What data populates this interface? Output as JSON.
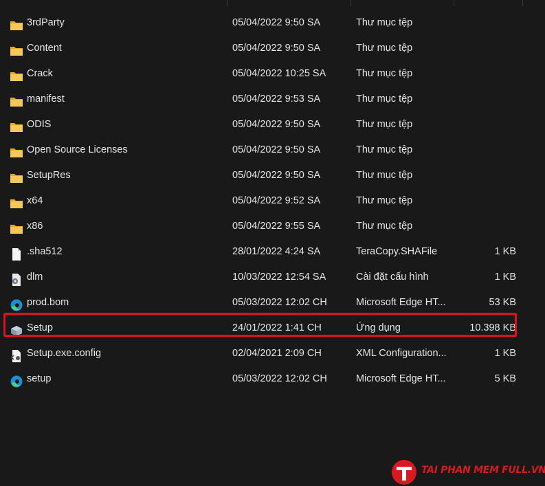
{
  "files": [
    {
      "name": "3rdParty",
      "date": "05/04/2022 9:50 SA",
      "type": "Thư mục tệp",
      "size": "",
      "icon": "folder-icon"
    },
    {
      "name": "Content",
      "date": "05/04/2022 9:50 SA",
      "type": "Thư mục tệp",
      "size": "",
      "icon": "folder-icon"
    },
    {
      "name": "Crack",
      "date": "05/04/2022 10:25 SA",
      "type": "Thư mục tệp",
      "size": "",
      "icon": "folder-icon"
    },
    {
      "name": "manifest",
      "date": "05/04/2022 9:53 SA",
      "type": "Thư mục tệp",
      "size": "",
      "icon": "folder-icon"
    },
    {
      "name": "ODIS",
      "date": "05/04/2022 9:50 SA",
      "type": "Thư mục tệp",
      "size": "",
      "icon": "folder-icon"
    },
    {
      "name": "Open Source Licenses",
      "date": "05/04/2022 9:50 SA",
      "type": "Thư mục tệp",
      "size": "",
      "icon": "folder-icon"
    },
    {
      "name": "SetupRes",
      "date": "05/04/2022 9:50 SA",
      "type": "Thư mục tệp",
      "size": "",
      "icon": "folder-icon"
    },
    {
      "name": "x64",
      "date": "05/04/2022 9:52 SA",
      "type": "Thư mục tệp",
      "size": "",
      "icon": "folder-icon"
    },
    {
      "name": "x86",
      "date": "05/04/2022 9:55 SA",
      "type": "Thư mục tệp",
      "size": "",
      "icon": "folder-icon"
    },
    {
      "name": ".sha512",
      "date": "28/01/2022 4:24 SA",
      "type": "TeraCopy.SHAFile",
      "size": "1 KB",
      "icon": "file-icon"
    },
    {
      "name": "dlm",
      "date": "10/03/2022 12:54 SA",
      "type": "Cài đặt cấu hình",
      "size": "1 KB",
      "icon": "config-file-icon"
    },
    {
      "name": "prod.bom",
      "date": "05/03/2022 12:02 CH",
      "type": "Microsoft Edge HT...",
      "size": "53 KB",
      "icon": "edge-icon"
    },
    {
      "name": "Setup",
      "date": "24/01/2022 1:41 CH",
      "type": "Ứng dụng",
      "size": "10.398 KB",
      "icon": "installer-icon",
      "highlighted": true
    },
    {
      "name": "Setup.exe.config",
      "date": "02/04/2021 2:09 CH",
      "type": "XML Configuration...",
      "size": "1 KB",
      "icon": "xml-config-icon"
    },
    {
      "name": "setup",
      "date": "05/03/2022 12:02 CH",
      "type": "Microsoft Edge HT...",
      "size": "5 KB",
      "icon": "edge-icon"
    }
  ],
  "watermark": {
    "text": "TAI PHAN MEM FULL.VN",
    "logo_letter": "T",
    "color": "#d71920"
  },
  "colors": {
    "background": "#191919",
    "text": "#e6e6e6",
    "highlight_border": "#e10f1a",
    "folder": "#f3c14f"
  }
}
